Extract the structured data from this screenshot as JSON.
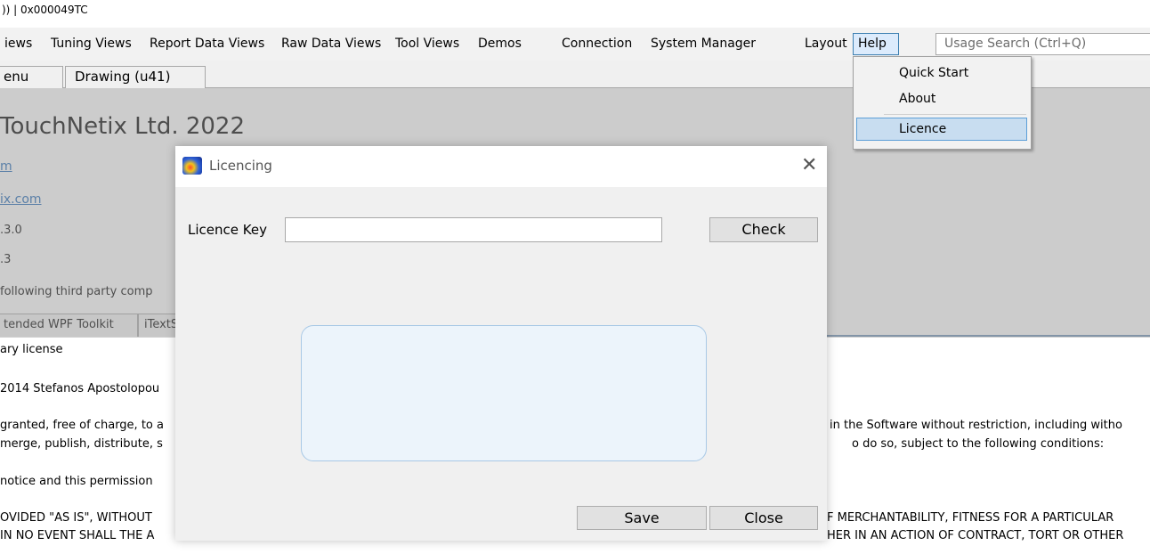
{
  "window": {
    "title_fragment": ")) | 0x000049TC"
  },
  "menu": {
    "items": [
      "iews",
      "Tuning Views",
      "Report Data Views",
      "Raw Data Views",
      "Tool Views",
      "Demos",
      "Connection",
      "System Manager",
      "Layout"
    ],
    "help": "Help",
    "search_placeholder": "Usage Search (Ctrl+Q)"
  },
  "tabs": [
    "enu",
    "Drawing (u41)"
  ],
  "content": {
    "heading": "TouchNetix Ltd. 2022",
    "link1": "m",
    "link2": "ix.com",
    "version1": ".3.0",
    "version2": ".3",
    "third_party": "following third party comp",
    "component_tabs": [
      "tended WPF Toolkit",
      "iTextS"
    ],
    "license_type": "ary license",
    "copyright": "2014 Stefanos Apostolopou",
    "granted": "granted, free of charge, to a",
    "granted_right": "in the Software without restriction, including witho",
    "merge": "merge, publish, distribute, s",
    "merge_right": "o do so, subject to the following conditions:",
    "notice": "notice and this permission",
    "provided": "OVIDED \"AS IS\", WITHOUT",
    "provided_right": "F MERCHANTABILITY, FITNESS FOR A PARTICULAR",
    "no_event_left": "IN NO EVENT SHALL THE A",
    "no_event_right": "HER IN AN ACTION OF CONTRACT, TORT OR OTHER"
  },
  "help_menu": {
    "items": [
      "Quick Start",
      "About",
      "Licence"
    ]
  },
  "dialog": {
    "title": "Licencing",
    "close_glyph": "✕",
    "licence_key_label": "Licence Key",
    "licence_key_value": "",
    "check_label": "Check",
    "save_label": "Save",
    "close_label": "Close",
    "message": ""
  }
}
